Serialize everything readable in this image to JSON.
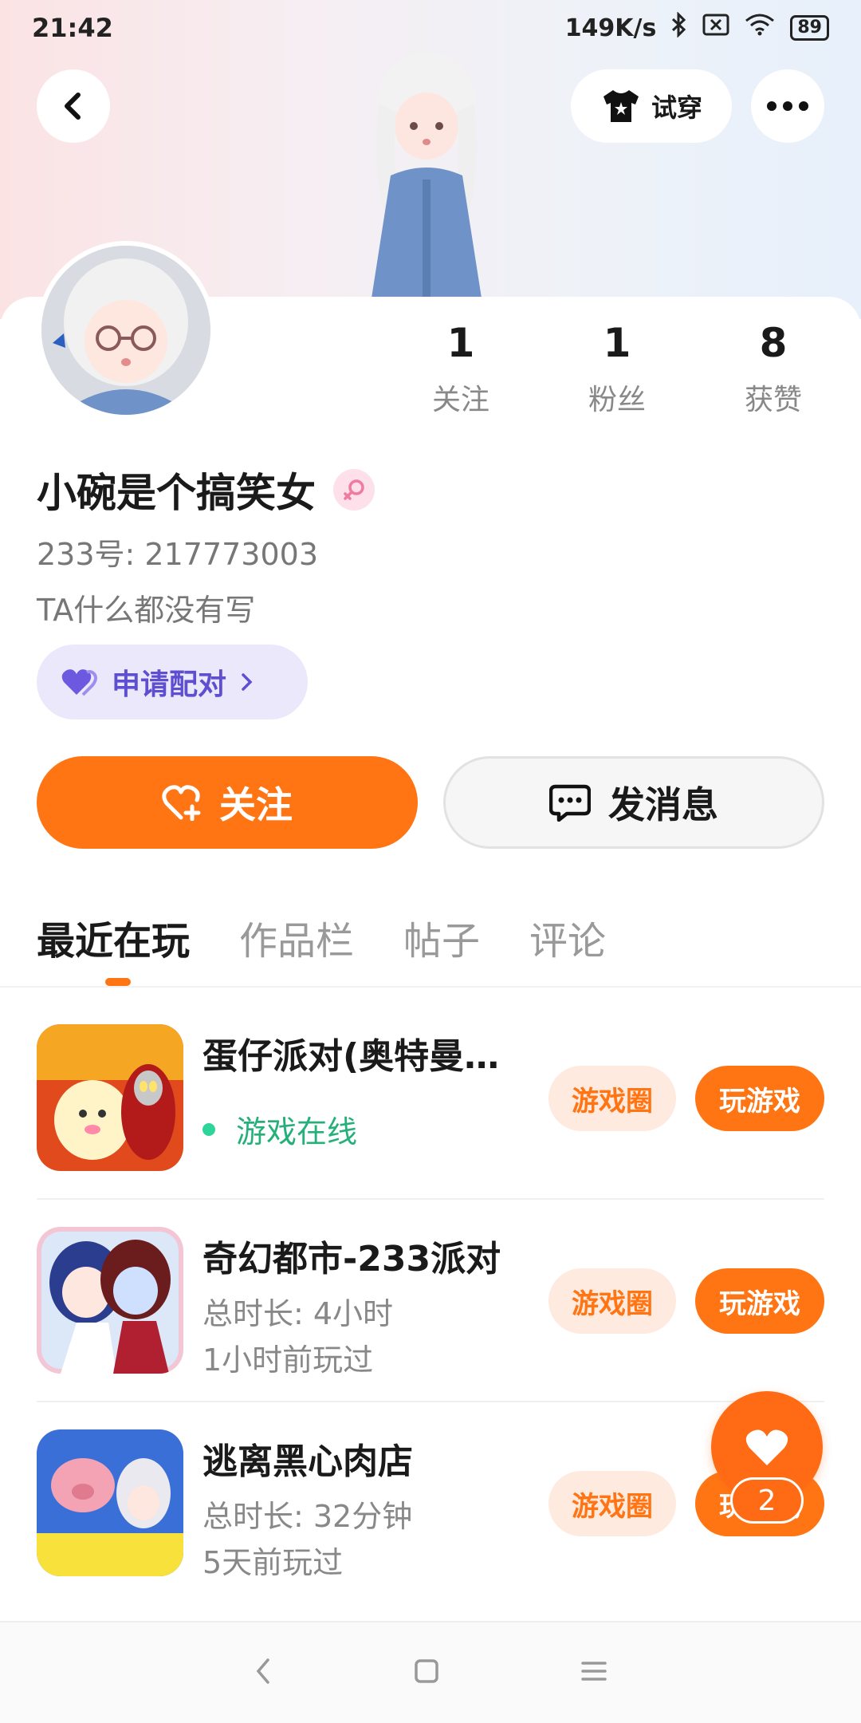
{
  "status_bar": {
    "time": "21:42",
    "network_speed": "149K/s",
    "battery": "89"
  },
  "header": {
    "try_on_label": "试穿"
  },
  "profile": {
    "nickname": "小碗是个搞笑女",
    "uid": "233号: 217773003",
    "bio": "TA什么都没有写",
    "pair_label": "申请配对",
    "stats": [
      {
        "value": "1",
        "label": "关注"
      },
      {
        "value": "1",
        "label": "粉丝"
      },
      {
        "value": "8",
        "label": "获赞"
      }
    ]
  },
  "actions": {
    "follow_label": "关注",
    "message_label": "发消息"
  },
  "tabs": [
    "最近在玩",
    "作品栏",
    "帖子",
    "评论"
  ],
  "games": [
    {
      "title": "蛋仔派对(奥特曼…",
      "status": "游戏在线",
      "circle_label": "游戏圈",
      "play_label": "玩游戏"
    },
    {
      "title": "奇幻都市-233派对",
      "duration": "总时长: 4小时",
      "last_played": "1小时前玩过",
      "circle_label": "游戏圈",
      "play_label": "玩游戏"
    },
    {
      "title": "逃离黑心肉店",
      "duration": "总时长: 32分钟",
      "last_played": "5天前玩过",
      "circle_label": "游戏圈",
      "play_label": "玩游戏"
    }
  ],
  "like_count": "2",
  "colors": {
    "accent": "#ff7514",
    "online": "#25b07a",
    "pair": "#5d4fd0"
  }
}
